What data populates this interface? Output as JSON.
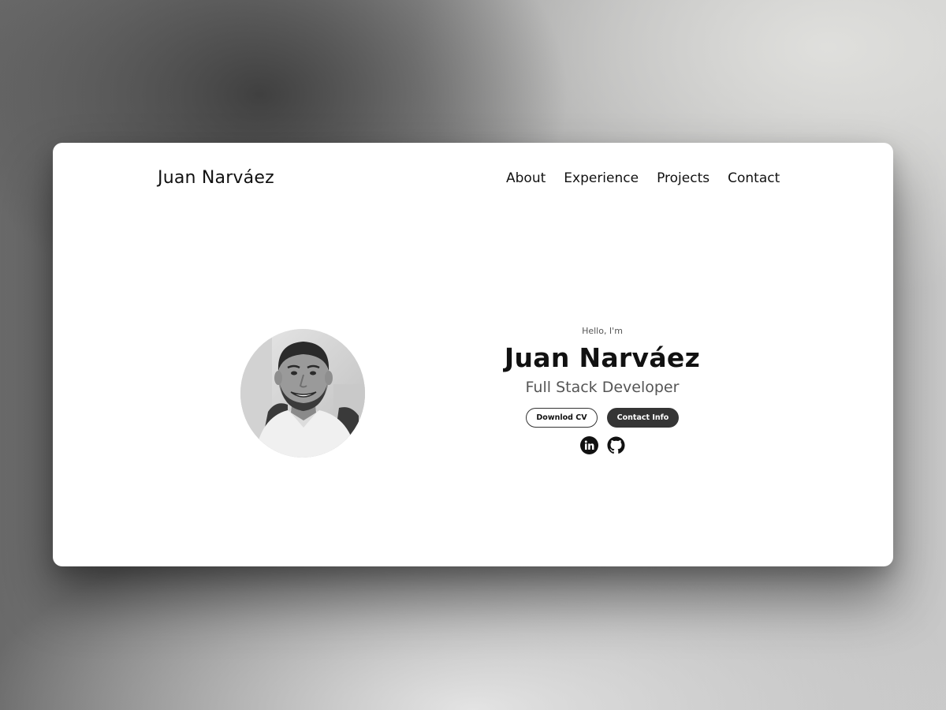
{
  "header": {
    "logo": "Juan Narváez",
    "nav": [
      {
        "label": "About"
      },
      {
        "label": "Experience"
      },
      {
        "label": "Projects"
      },
      {
        "label": "Contact"
      }
    ]
  },
  "hero": {
    "greeting": "Hello, I'm",
    "name": "Juan Narváez",
    "title": "Full Stack Developer",
    "buttons": {
      "download": "Downlod CV",
      "contact": "Contact Info"
    },
    "social": [
      {
        "icon": "linkedin-icon"
      },
      {
        "icon": "github-icon"
      }
    ],
    "avatar": "profile-photo"
  },
  "colors": {
    "text": "#111111",
    "muted": "#555555",
    "button_dark": "#353535",
    "card": "#ffffff"
  }
}
